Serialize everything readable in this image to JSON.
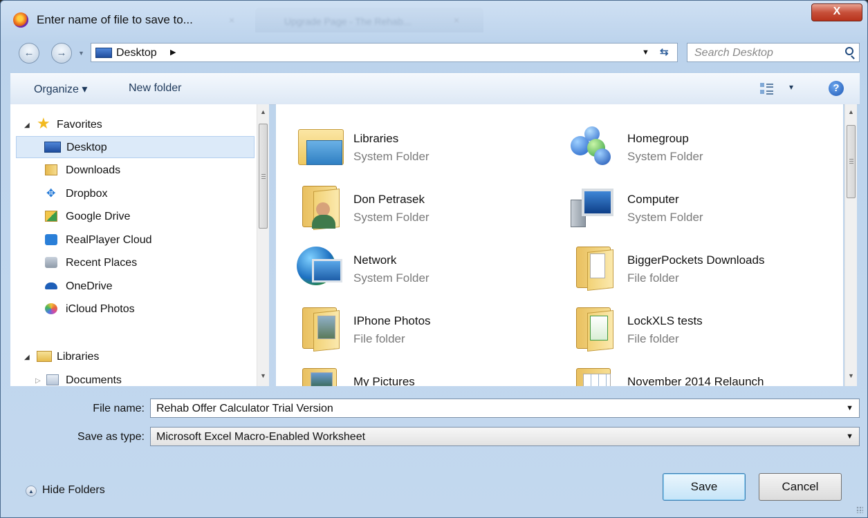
{
  "window": {
    "title": "Enter name of file to save to...",
    "background_tab": "Upgrade Page - The Rehab...",
    "close_glyph": "X",
    "tab_close_glyph": "×"
  },
  "nav": {
    "back_glyph": "←",
    "forward_glyph": "→",
    "address_crumb": "Desktop",
    "address_sep": "▶",
    "dropdown_glyph": "▼",
    "refresh_glyph": "⇆",
    "search_placeholder": "Search Desktop"
  },
  "toolbar": {
    "organize": "Organize ▾",
    "new_folder": "New folder",
    "view_menu_glyph": "▾",
    "help_glyph": "?"
  },
  "sidebar": {
    "sections": [
      {
        "label": "Favorites",
        "expanded": true,
        "items": [
          {
            "label": "Desktop",
            "icon": "desktop-icon",
            "selected": true
          },
          {
            "label": "Downloads",
            "icon": "downloads-icon"
          },
          {
            "label": "Dropbox",
            "icon": "dropbox-icon"
          },
          {
            "label": "Google Drive",
            "icon": "google-drive-icon"
          },
          {
            "label": "RealPlayer Cloud",
            "icon": "realplayer-cloud-icon"
          },
          {
            "label": "Recent Places",
            "icon": "recent-places-icon"
          },
          {
            "label": "OneDrive",
            "icon": "onedrive-icon"
          },
          {
            "label": "iCloud Photos",
            "icon": "icloud-photos-icon"
          }
        ]
      },
      {
        "label": "Libraries",
        "expanded": true,
        "items": [
          {
            "label": "Documents",
            "icon": "documents-icon"
          }
        ]
      }
    ]
  },
  "files": [
    {
      "name": "Libraries",
      "type": "System Folder",
      "icon": "libraries-folder-icon"
    },
    {
      "name": "Homegroup",
      "type": "System Folder",
      "icon": "homegroup-icon"
    },
    {
      "name": "Don Petrasek",
      "type": "System Folder",
      "icon": "user-folder-icon"
    },
    {
      "name": "Computer",
      "type": "System Folder",
      "icon": "computer-icon"
    },
    {
      "name": "Network",
      "type": "System Folder",
      "icon": "network-icon"
    },
    {
      "name": "BiggerPockets Downloads",
      "type": "File folder",
      "icon": "folder-icon"
    },
    {
      "name": "IPhone Photos",
      "type": "File folder",
      "icon": "photo-folder-icon"
    },
    {
      "name": "LockXLS tests",
      "type": "File folder",
      "icon": "folder-icon"
    },
    {
      "name": "My Pictures",
      "type": "",
      "icon": "pictures-folder-icon"
    },
    {
      "name": "November 2014 Relaunch",
      "type": "",
      "icon": "spreadsheet-folder-icon"
    }
  ],
  "form": {
    "file_name_label": "File name:",
    "file_name_value": "Rehab Offer Calculator Trial Version",
    "save_type_label": "Save as type:",
    "save_type_value": "Microsoft Excel Macro-Enabled Worksheet",
    "dropdown_glyph": "▼"
  },
  "footer": {
    "hide_folders": "Hide Folders",
    "hide_glyph": "▲",
    "save": "Save",
    "cancel": "Cancel"
  },
  "scroll_glyphs": {
    "up": "▲",
    "down": "▼"
  },
  "colors": {
    "selection": "#dceaf9",
    "accent": "#3c7fb1",
    "close_red": "#c7503a"
  }
}
